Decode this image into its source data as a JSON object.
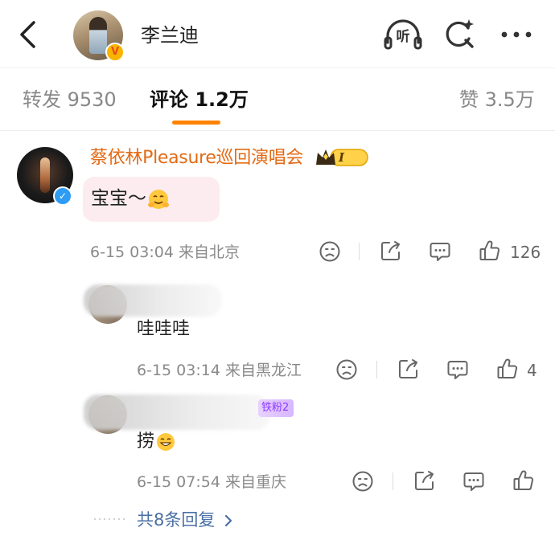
{
  "header": {
    "back_icon": "chevron-left-icon",
    "title": "李兰迪",
    "listen_label": "听",
    "listen_icon": "headphones-icon",
    "search_icon": "ai-search-icon",
    "more_icon": "more-dots-icon"
  },
  "tabs": [
    {
      "label": "转发 9530",
      "active": false
    },
    {
      "label": "评论 1.2万",
      "active": true
    },
    {
      "label": "赞 3.5万",
      "active": false
    }
  ],
  "accent_color": "#ff8200",
  "comment": {
    "author": "蔡依林Pleasure巡回演唱会",
    "badge_level": "I",
    "text": "宝宝～",
    "emoji": "hug-face-emoji",
    "time": "6-15 03:04",
    "location": "来自北京",
    "like_count": "126",
    "bubble_color": "#fcecef",
    "author_color": "#e36a14"
  },
  "replies": [
    {
      "text": "哇哇哇",
      "time": "6-15 03:14",
      "location": "来自黑龙江",
      "like_count": "4"
    },
    {
      "text": "捞",
      "emoji": "grin-face-emoji",
      "fan_badge": "铁粉2",
      "time": "6-15 07:54",
      "location": "来自重庆",
      "like_count": ""
    }
  ],
  "more_replies": {
    "label": "共8条回复",
    "icon": "chevron-right-icon"
  }
}
